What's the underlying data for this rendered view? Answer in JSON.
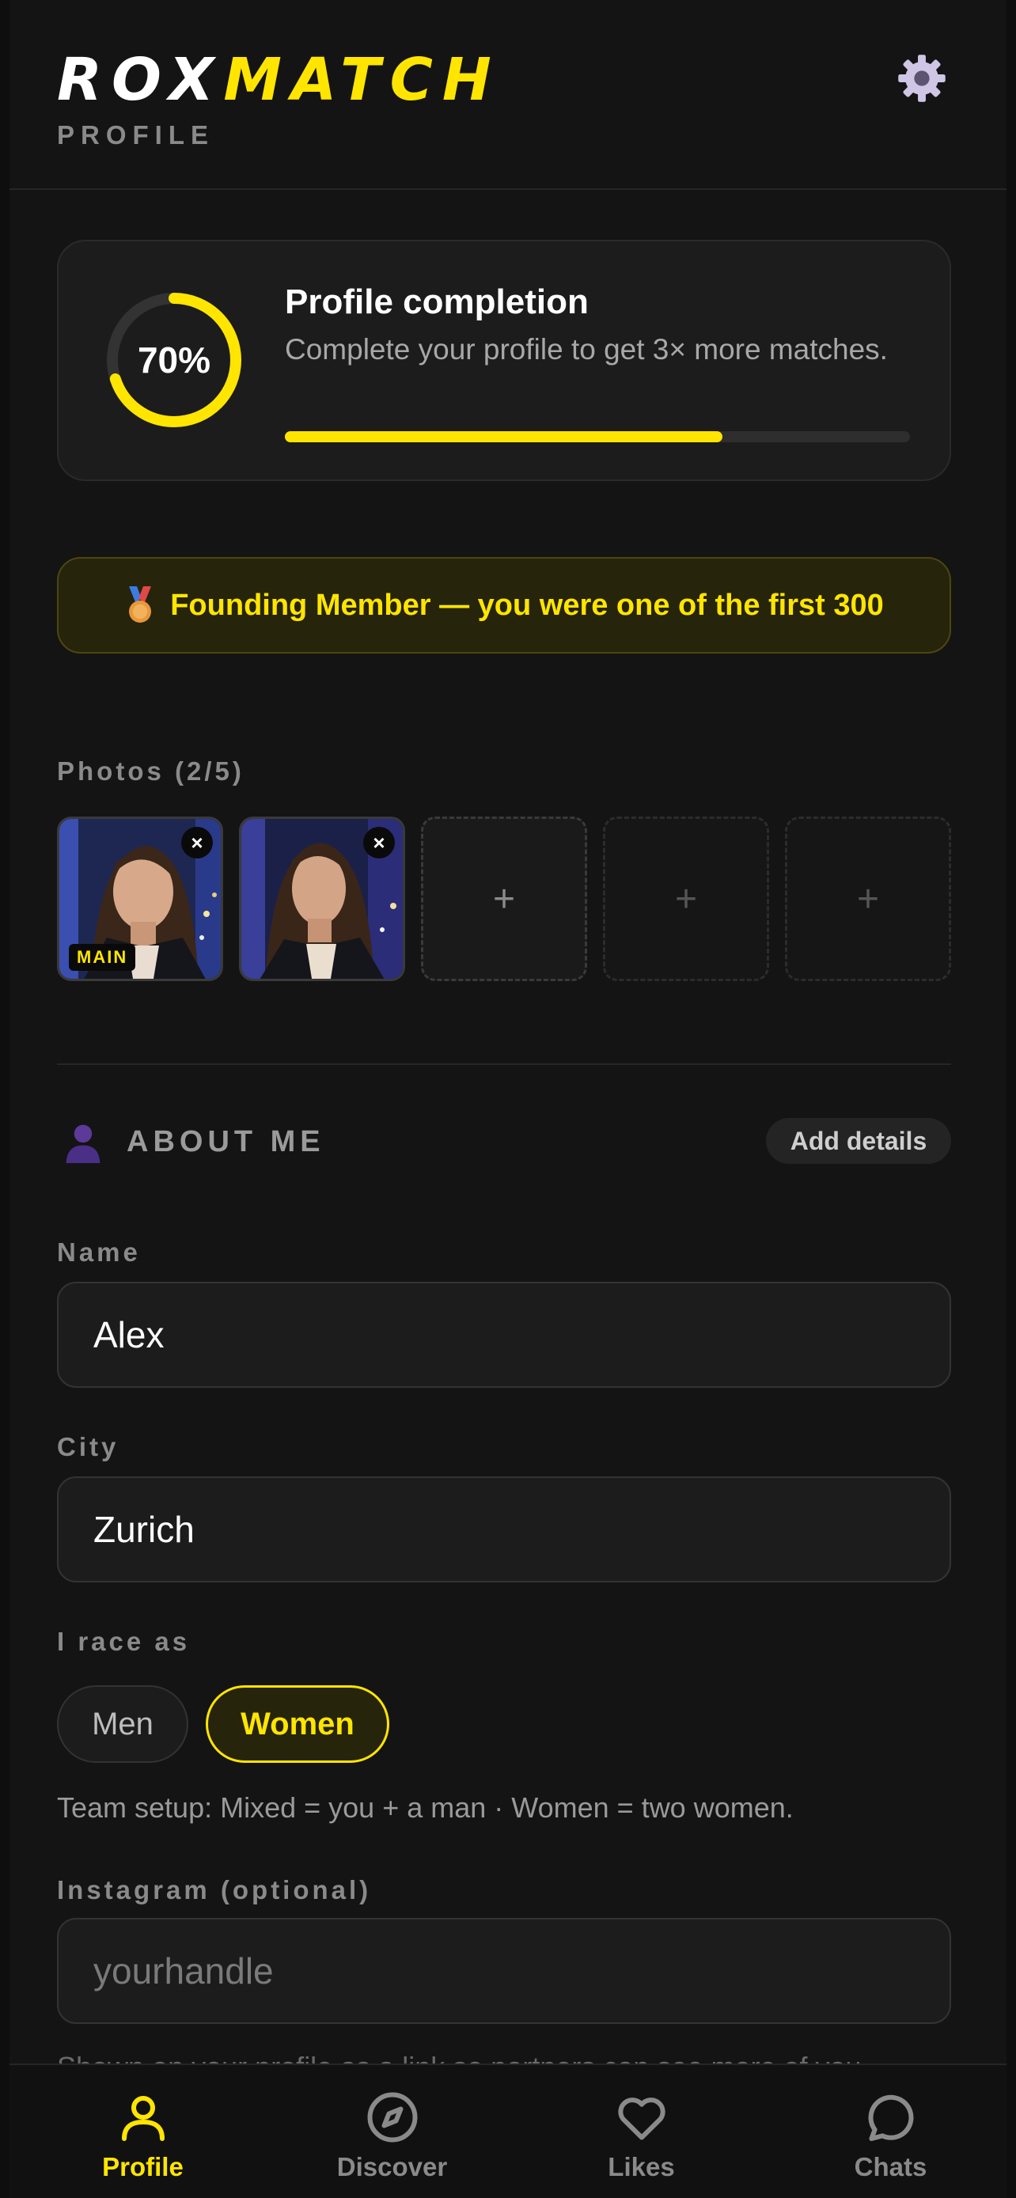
{
  "colors": {
    "accent": "#ffe500",
    "background": "#141414",
    "card": "#1c1c1c",
    "muted": "#8a8a8a"
  },
  "header": {
    "logo_part1": "ROX",
    "logo_part2": "MATCH",
    "subtitle": "PROFILE",
    "settings_icon": "gear-icon"
  },
  "completion": {
    "percent_label": "70%",
    "percent": 0.7,
    "title": "Profile completion",
    "description": "Complete your profile to get 3× more matches."
  },
  "banner": {
    "icon": "medal-icon",
    "text": "Founding Member — you were one of the first 300"
  },
  "photos": {
    "label": "Photos (2/5)",
    "main_badge": "MAIN",
    "remove_glyph": "×",
    "add_glyph": "+"
  },
  "about": {
    "icon": "person-icon",
    "title": "ABOUT ME",
    "add_details": "Add details"
  },
  "form": {
    "name_label": "Name",
    "name_value": "Alex",
    "city_label": "City",
    "city_value": "Zurich",
    "race_label": "I race as",
    "race_options": [
      "Men",
      "Women"
    ],
    "race_selected": "Women",
    "team_hint": "Team setup: Mixed = you + a man · Women = two women.",
    "instagram_label": "Instagram (optional)",
    "instagram_placeholder": "yourhandle",
    "instagram_hint": "Shown on your profile as a link so partners can see more of you."
  },
  "nav": {
    "items": [
      {
        "label": "Profile",
        "icon": "person-icon",
        "active": true
      },
      {
        "label": "Discover",
        "icon": "compass-icon",
        "active": false
      },
      {
        "label": "Likes",
        "icon": "heart-icon",
        "active": false
      },
      {
        "label": "Chats",
        "icon": "chat-bubble-icon",
        "active": false
      }
    ]
  }
}
